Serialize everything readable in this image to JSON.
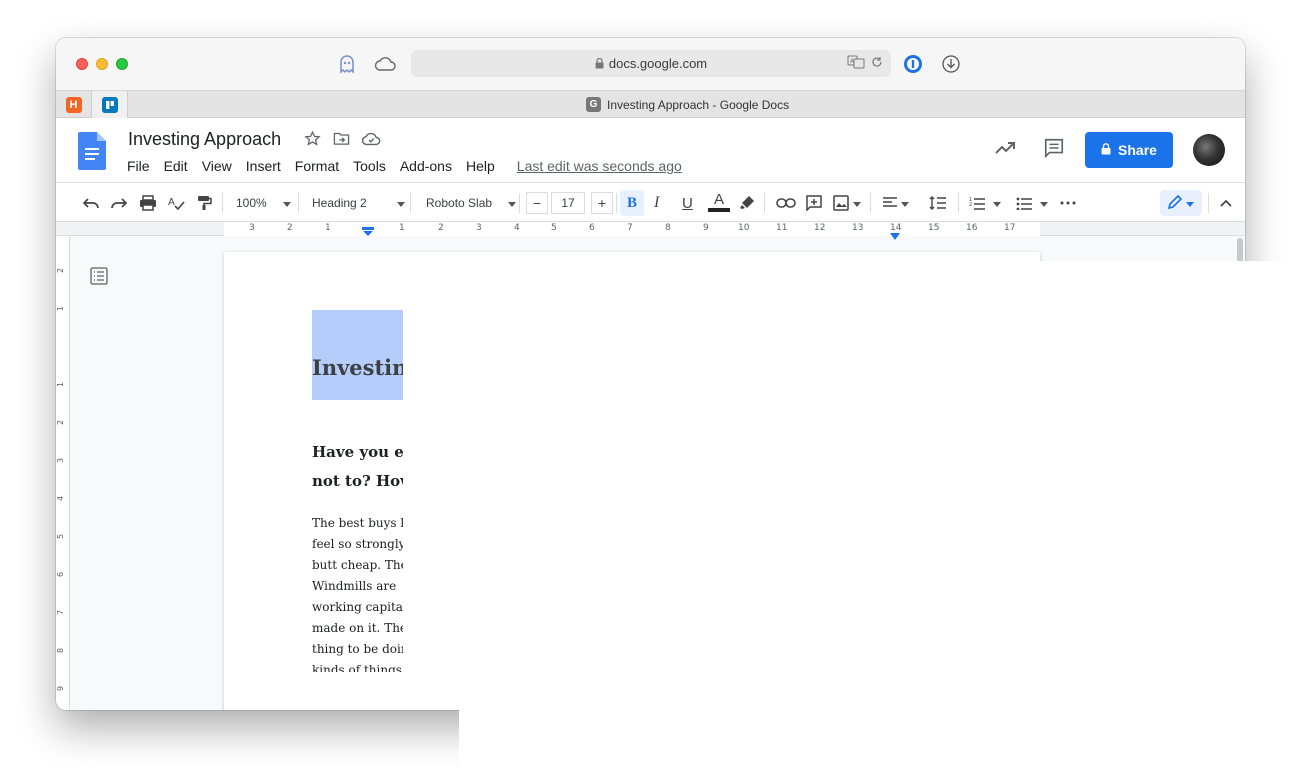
{
  "browser": {
    "url": "docs.google.com",
    "tab_title": "Investing Approach - Google Docs",
    "tab_favicon_letter": "G",
    "pinned_tabs": [
      {
        "letter": "H",
        "color": "#f26522"
      },
      {
        "letter": "",
        "color": "#0079bf"
      }
    ]
  },
  "doc": {
    "title": "Investing Approach",
    "last_edit": "Last edit seconds ago",
    "share_label": "Share",
    "menu": [
      "File",
      "Edit",
      "View",
      "Insert",
      "Format",
      "Tools",
      "Add-ons",
      "Help"
    ],
    "last_edit_label": "Last edit was seconds ago"
  },
  "toolbar": {
    "zoom": "100%",
    "style": "Heading 2",
    "font": "Roboto Slab",
    "font_size": "17",
    "minus": "−",
    "plus": "+",
    "bold": "B",
    "italic": "I",
    "underline": "U",
    "text_color": "A"
  },
  "ruler": {
    "h_labels": [
      "3",
      "2",
      "1",
      "1",
      "2",
      "3",
      "4",
      "5",
      "6",
      "7",
      "8",
      "9",
      "10",
      "11",
      "12",
      "13",
      "14",
      "15",
      "16",
      "17"
    ],
    "v_labels": [
      "2",
      "1",
      "1",
      "2",
      "3",
      "4",
      "5",
      "6",
      "7",
      "8",
      "9"
    ]
  },
  "content": {
    "heading_visible": "Investing",
    "subheading_lines": [
      "Have you ev",
      "not to? How"
    ],
    "body_lines": [
      "The best buys l",
      "feel so strongly",
      "butt cheap. The",
      "Windmills are",
      "working capita",
      "made on it. The",
      "thing to be doin",
      "kinds of things"
    ]
  },
  "colors": {
    "accent": "#1a73e8",
    "selection": "#b5cdfb",
    "docs_blue": "#4285f4"
  }
}
